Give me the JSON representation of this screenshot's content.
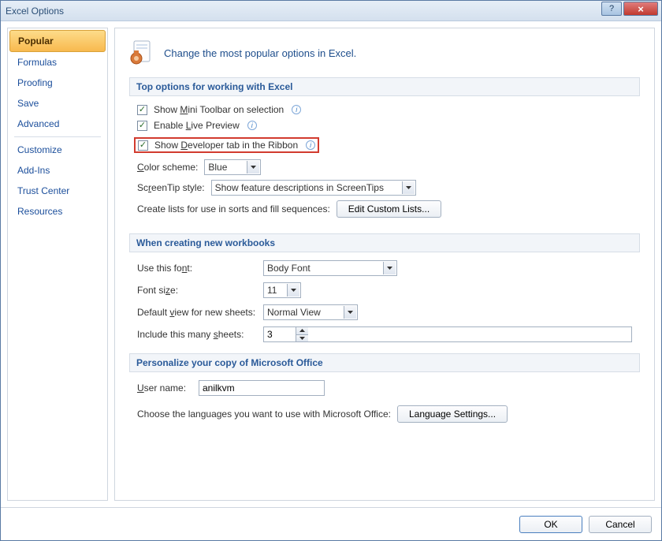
{
  "window": {
    "title": "Excel Options"
  },
  "sidebar": {
    "items": [
      {
        "label": "Popular",
        "active": true
      },
      {
        "label": "Formulas"
      },
      {
        "label": "Proofing"
      },
      {
        "label": "Save"
      },
      {
        "label": "Advanced"
      },
      {
        "divider": true
      },
      {
        "label": "Customize"
      },
      {
        "label": "Add-Ins"
      },
      {
        "label": "Trust Center"
      },
      {
        "label": "Resources"
      }
    ]
  },
  "header_text": "Change the most popular options in Excel.",
  "section1": {
    "title": "Top options for working with Excel",
    "chk_minitoolbar": "Show Mini Toolbar on selection",
    "chk_livepreview": "Enable Live Preview",
    "chk_developer": "Show Developer tab in the Ribbon",
    "color_label": "Color scheme:",
    "color_value": "Blue",
    "screentip_label": "ScreenTip style:",
    "screentip_value": "Show feature descriptions in ScreenTips",
    "lists_label": "Create lists for use in sorts and fill sequences:",
    "lists_button": "Edit Custom Lists..."
  },
  "section2": {
    "title": "When creating new workbooks",
    "font_label": "Use this font:",
    "font_value": "Body Font",
    "size_label": "Font size:",
    "size_value": "11",
    "view_label": "Default view for new sheets:",
    "view_value": "Normal View",
    "sheets_label": "Include this many sheets:",
    "sheets_value": "3"
  },
  "section3": {
    "title": "Personalize your copy of Microsoft Office",
    "user_label": "User name:",
    "user_value": "anilkvm",
    "lang_label": "Choose the languages you want to use with Microsoft Office:",
    "lang_button": "Language Settings..."
  },
  "footer": {
    "ok": "OK",
    "cancel": "Cancel"
  }
}
